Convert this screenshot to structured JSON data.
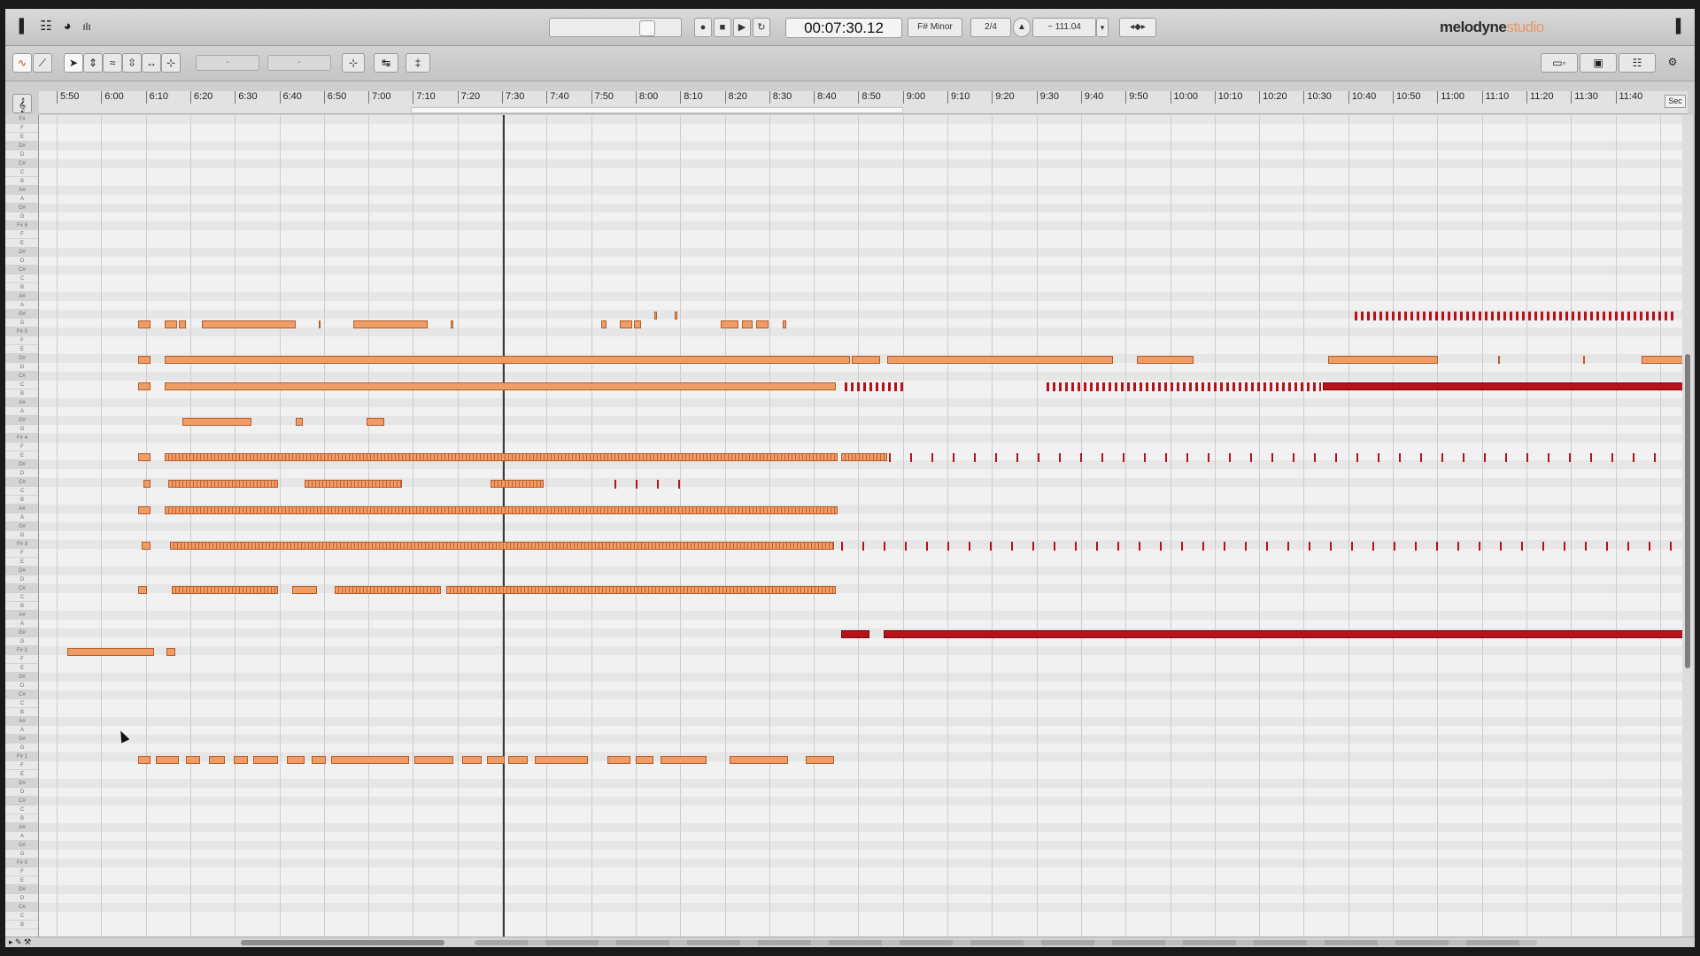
{
  "app": {
    "logo_main": "melodyne",
    "logo_sub": "studio"
  },
  "transport": {
    "time": "00:07:30.12",
    "key": "F# Minor",
    "meter": "2/4",
    "tempo": "~ 111.04",
    "record_icon": "record-icon",
    "stop_icon": "stop-icon",
    "play_icon": "play-icon",
    "loop_icon": "loop-icon"
  },
  "ruler": {
    "units_label": "Sec",
    "ticks": [
      "5:50",
      "6:00",
      "6:10",
      "6:20",
      "6:30",
      "6:40",
      "6:50",
      "7:00",
      "7:10",
      "7:20",
      "7:30",
      "7:40",
      "7:50",
      "8:00",
      "8:10",
      "8:20",
      "8:30",
      "8:40",
      "8:50",
      "9:00",
      "9:10",
      "9:20",
      "9:30",
      "9:40",
      "9:50",
      "10:00",
      "10:10",
      "10:20",
      "10:30",
      "10:40",
      "10:50",
      "11:00",
      "11:10",
      "11:20",
      "11:30",
      "11:40"
    ]
  },
  "keyboard": {
    "keys": [
      "F#",
      "F",
      "E",
      "D#",
      "D",
      "C#",
      "C",
      "B",
      "A#",
      "A",
      "G#",
      "G",
      "F# 6",
      "F",
      "E",
      "D#",
      "D",
      "C#",
      "C",
      "B",
      "A#",
      "A",
      "G#",
      "G",
      "F# 5",
      "F",
      "E",
      "D#",
      "D",
      "C#",
      "C",
      "B",
      "A#",
      "A",
      "G#",
      "G",
      "F# 4",
      "F",
      "E",
      "D#",
      "D",
      "C#",
      "C",
      "B",
      "A#",
      "A",
      "G#",
      "G",
      "F# 3",
      "F",
      "E",
      "D#",
      "D",
      "C#",
      "C",
      "B",
      "A#",
      "A",
      "G#",
      "G",
      "F# 2",
      "F",
      "E",
      "D#",
      "D",
      "C#",
      "C",
      "B",
      "A#",
      "A",
      "G#",
      "G",
      "F# 1",
      "F",
      "E",
      "D#",
      "D",
      "C#",
      "C",
      "B",
      "A#",
      "A",
      "G#",
      "G",
      "F# 0",
      "F",
      "E",
      "D#",
      "D",
      "C#",
      "C",
      "B"
    ]
  },
  "colors": {
    "note_orange": "#ef9d65",
    "note_red": "#b5121a",
    "grid_bg": "#f1f1f1"
  }
}
